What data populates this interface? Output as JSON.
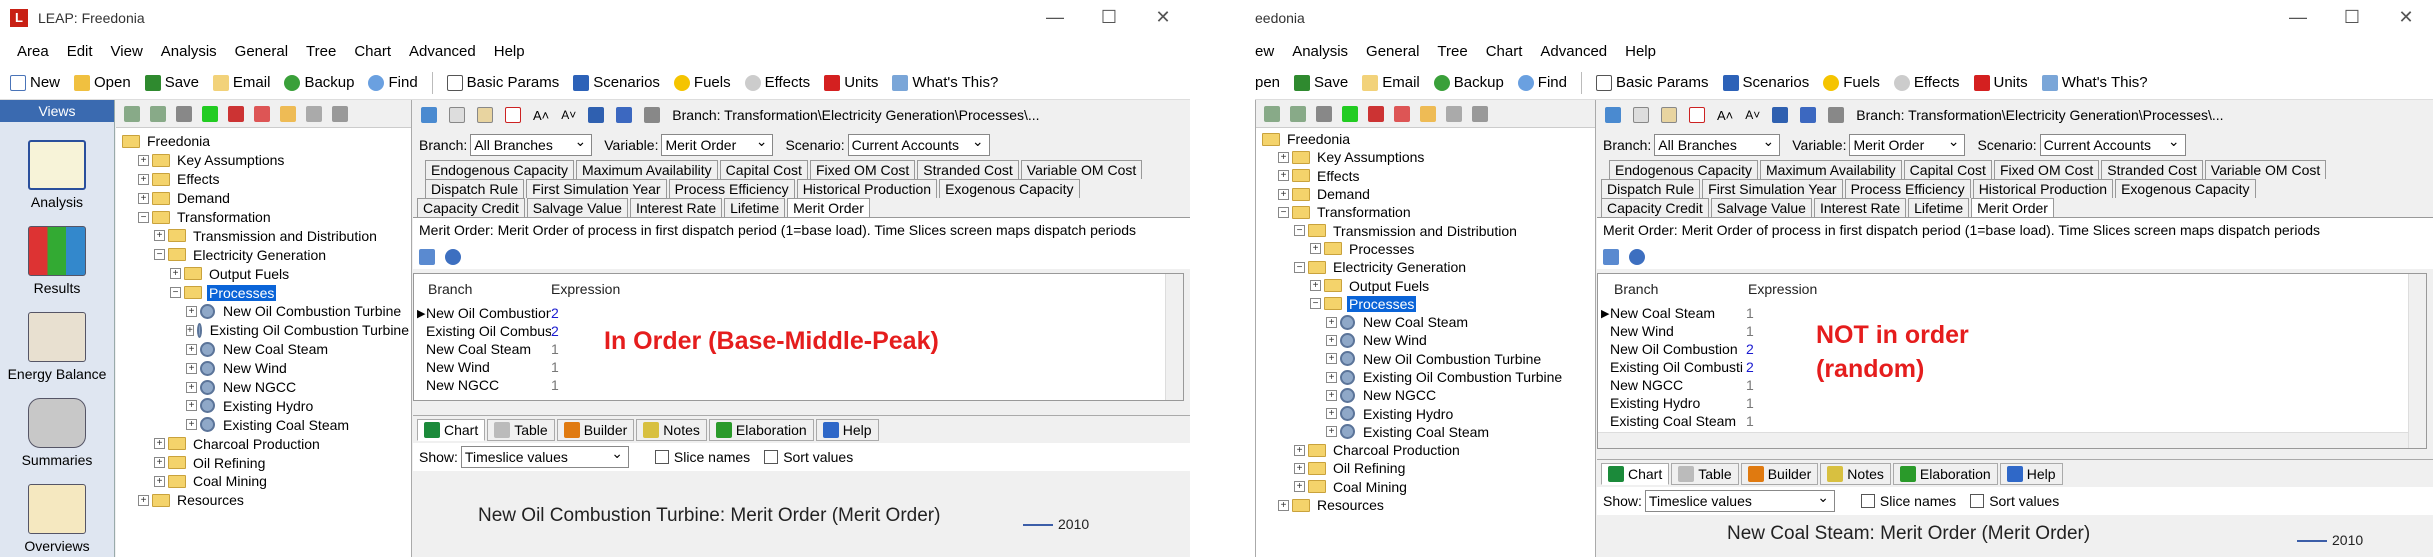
{
  "left": {
    "title": "LEAP: Freedonia",
    "win_min": "—",
    "win_max": "☐",
    "win_close": "✕",
    "menu": [
      "Area",
      "Edit",
      "View",
      "Analysis",
      "General",
      "Tree",
      "Chart",
      "Advanced",
      "Help"
    ],
    "toolbar": {
      "new": "New",
      "open": "Open",
      "save": "Save",
      "email": "Email",
      "backup": "Backup",
      "find": "Find",
      "basic_params": "Basic Params",
      "scenarios": "Scenarios",
      "fuels": "Fuels",
      "effects": "Effects",
      "units": "Units",
      "whats_this": "What's This?"
    },
    "views": {
      "header": "Views",
      "items": [
        "Analysis",
        "Results",
        "Energy Balance",
        "Summaries",
        "Overviews"
      ]
    },
    "tree": [
      "Freedonia",
      "Key Assumptions",
      "Effects",
      "Demand",
      "Transformation",
      "Transmission and Distribution",
      "Electricity Generation",
      "Output Fuels",
      "Processes",
      "New Oil Combustion Turbine",
      "Existing Oil Combustion Turbine",
      "New Coal Steam",
      "New Wind",
      "New NGCC",
      "Existing Hydro",
      "Existing Coal Steam",
      "Charcoal Production",
      "Oil Refining",
      "Coal Mining",
      "Resources"
    ],
    "branch_path": "Branch: Transformation\\Electricity Generation\\Processes\\...",
    "branch_label": "Branch:",
    "branch_value": "All Branches",
    "variable_label": "Variable:",
    "variable_value": "Merit Order",
    "scenario_label": "Scenario:",
    "scenario_value": "Current Accounts",
    "tabs_row1": [
      "Endogenous Capacity",
      "Maximum Availability",
      "Capital Cost",
      "Fixed OM Cost",
      "Stranded Cost",
      "Variable OM Cost"
    ],
    "tabs_row2": [
      "Dispatch Rule",
      "First Simulation Year",
      "Process Efficiency",
      "Historical Production",
      "Exogenous Capacity"
    ],
    "tabs_row3": [
      "Capacity Credit",
      "Salvage Value",
      "Interest Rate",
      "Lifetime",
      "Merit Order"
    ],
    "description": "Merit Order: Merit Order of process in first dispatch period (1=base load). Time Slices screen maps dispatch periods",
    "grid_headers": [
      "Branch",
      "Expression"
    ],
    "rows": [
      {
        "branch": "New Oil Combustion",
        "expr": "2"
      },
      {
        "branch": "Existing Oil Combusti",
        "expr": "2"
      },
      {
        "branch": "New Coal Steam",
        "expr": "1"
      },
      {
        "branch": "New Wind",
        "expr": "1"
      },
      {
        "branch": "New NGCC",
        "expr": "1"
      }
    ],
    "annotation": "In Order (Base-Middle-Peak)",
    "bottom_tabs": [
      "Chart",
      "Table",
      "Builder",
      "Notes",
      "Elaboration",
      "Help"
    ],
    "show_label": "Show:",
    "show_value": "Timeslice values",
    "slice_names": "Slice names",
    "sort_values": "Sort values",
    "chart_title": "New Oil Combustion Turbine: Merit Order (Merit Order)",
    "legend_year": "2010"
  },
  "right": {
    "title": "eedonia",
    "win_min": "—",
    "win_max": "☐",
    "win_close": "✕",
    "menu": [
      "ew",
      "Analysis",
      "General",
      "Tree",
      "Chart",
      "Advanced",
      "Help"
    ],
    "toolbar": {
      "open": "pen",
      "save": "Save",
      "email": "Email",
      "backup": "Backup",
      "find": "Find",
      "basic_params": "Basic Params",
      "scenarios": "Scenarios",
      "fuels": "Fuels",
      "effects": "Effects",
      "units": "Units",
      "whats_this": "What's This?"
    },
    "tree": [
      "Freedonia",
      "Key Assumptions",
      "Effects",
      "Demand",
      "Transformation",
      "Transmission and Distribution",
      "Processes",
      "Electricity Generation",
      "Output Fuels",
      "Processes",
      "New Coal Steam",
      "New Wind",
      "New Oil Combustion Turbine",
      "Existing Oil Combustion Turbine",
      "New NGCC",
      "Existing Hydro",
      "Existing Coal Steam",
      "Charcoal Production",
      "Oil Refining",
      "Coal Mining",
      "Resources"
    ],
    "branch_path": "Branch: Transformation\\Electricity Generation\\Processes\\...",
    "branch_label": "Branch:",
    "branch_value": "All Branches",
    "variable_label": "Variable:",
    "variable_value": "Merit Order",
    "scenario_label": "Scenario:",
    "scenario_value": "Current Accounts",
    "tabs_row1": [
      "Endogenous Capacity",
      "Maximum Availability",
      "Capital Cost",
      "Fixed OM Cost",
      "Stranded Cost",
      "Variable OM Cost"
    ],
    "tabs_row2": [
      "Dispatch Rule",
      "First Simulation Year",
      "Process Efficiency",
      "Historical Production",
      "Exogenous Capacity"
    ],
    "tabs_row3": [
      "Capacity Credit",
      "Salvage Value",
      "Interest Rate",
      "Lifetime",
      "Merit Order"
    ],
    "description": "Merit Order: Merit Order of process in first dispatch period (1=base load). Time Slices screen maps dispatch periods",
    "grid_headers": [
      "Branch",
      "Expression"
    ],
    "rows": [
      {
        "branch": "New Coal Steam",
        "expr": "1"
      },
      {
        "branch": "New Wind",
        "expr": "1"
      },
      {
        "branch": "New Oil Combustion",
        "expr": "2"
      },
      {
        "branch": "Existing Oil Combusti",
        "expr": "2"
      },
      {
        "branch": "New NGCC",
        "expr": "1"
      },
      {
        "branch": "Existing Hydro",
        "expr": "1"
      },
      {
        "branch": "Existing Coal Steam",
        "expr": "1"
      }
    ],
    "annotation_line1": "NOT in order",
    "annotation_line2": "(random)",
    "bottom_tabs": [
      "Chart",
      "Table",
      "Builder",
      "Notes",
      "Elaboration",
      "Help"
    ],
    "show_label": "Show:",
    "show_value": "Timeslice values",
    "slice_names": "Slice names",
    "sort_values": "Sort values",
    "chart_title": "New Coal Steam: Merit Order (Merit Order)",
    "legend_year": "2010"
  }
}
